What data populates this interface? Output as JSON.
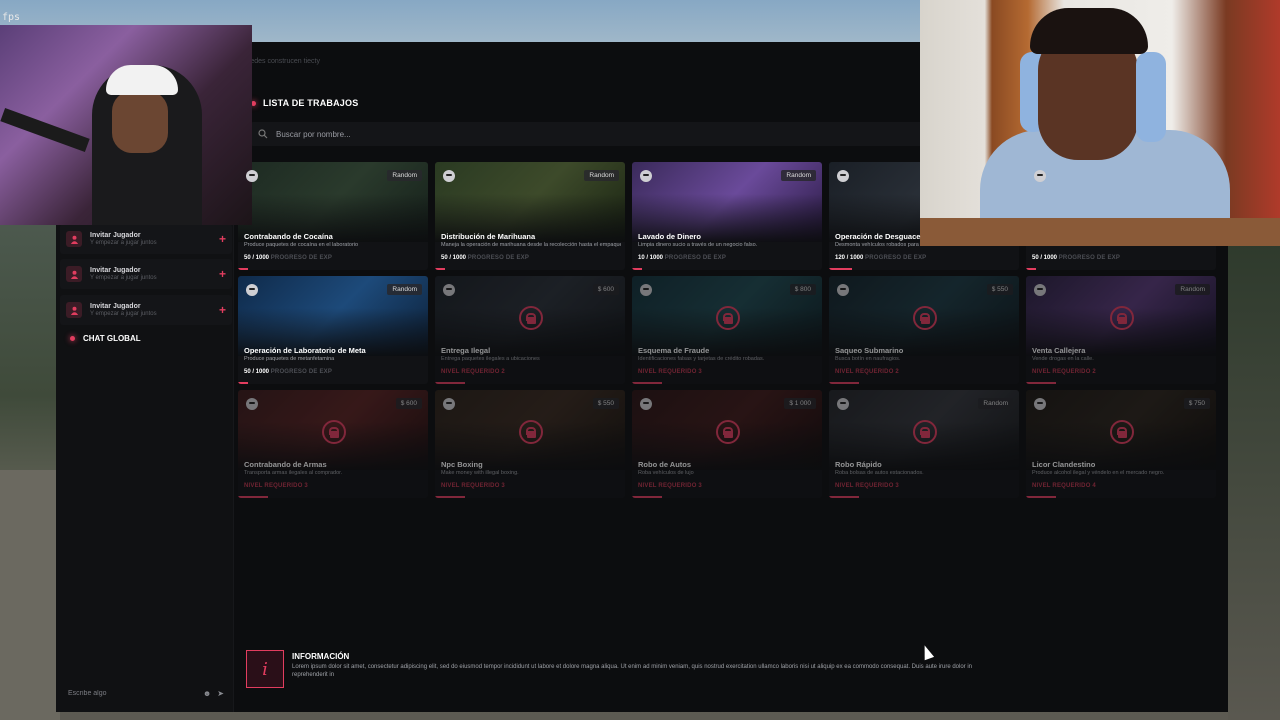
{
  "overlay": {
    "fps_label": "fps"
  },
  "header": {
    "breadcrumb": "redes construcen tiecty",
    "list_title": "LISTA DE TRABAJOS",
    "search_placeholder": "Buscar por nombre..."
  },
  "sidebar": {
    "invites": [
      {
        "name": "Invitar Jugador",
        "sub": "Y empezar a jugar juntos"
      },
      {
        "name": "Invitar Jugador",
        "sub": "Y empezar a jugar juntos"
      },
      {
        "name": "Invitar Jugador",
        "sub": "Y empezar a jugar juntos"
      }
    ],
    "chat_title": "CHAT GLOBAL",
    "chat_placeholder": "Escribe algo"
  },
  "progress_label": "PROGRESO DE EXP",
  "jobs": [
    {
      "title": "Contrabando de Cocaína",
      "desc": "Produce paquetes de cocaína en el laboratorio",
      "tag": "Random",
      "progress": "50 / 1000",
      "progress_fraction": 0.05,
      "locked": false
    },
    {
      "title": "Distribución de Marihuana",
      "desc": "Maneja la operación de marihuana desde la recolección hasta el empaquetado.",
      "tag": "Random",
      "progress": "50 / 1000",
      "progress_fraction": 0.05,
      "locked": false
    },
    {
      "title": "Lavado de Dinero",
      "desc": "Limpia dinero sucio a través de un negocio falso.",
      "tag": "Random",
      "progress": "10 / 1000",
      "progress_fraction": 0.01,
      "locked": false
    },
    {
      "title": "Operación de Desguace",
      "desc": "Desmonta vehículos robados para",
      "tag": "",
      "progress": "120 / 1000",
      "progress_fraction": 0.12,
      "locked": false
    },
    {
      "title": "",
      "desc": "",
      "tag": "",
      "progress": "50 / 1000",
      "progress_fraction": 0.05,
      "locked": false
    },
    {
      "title": "Operación de Laboratorio de Meta",
      "desc": "Produce paquetes de metanfetamina",
      "tag": "Random",
      "progress": "50 / 1000",
      "progress_fraction": 0.05,
      "locked": false
    },
    {
      "title": "Entrega Ilegal",
      "desc": "Entrega paquetes ilegales a ubicaciones",
      "tag": "$ 600",
      "requirement": "NIVEL REQUERIDO 2",
      "locked": true
    },
    {
      "title": "Esquema de Fraude",
      "desc": "Identificaciones falsas y tarjetas de crédito robadas.",
      "tag": "$ 800",
      "requirement": "NIVEL REQUERIDO 3",
      "locked": true
    },
    {
      "title": "Saqueo Submarino",
      "desc": "Busca botín en naufragios.",
      "tag": "$ 550",
      "requirement": "NIVEL REQUERIDO 2",
      "locked": true
    },
    {
      "title": "Venta Callejera",
      "desc": "Vende drogas en la calle.",
      "tag": "Random",
      "requirement": "NIVEL REQUERIDO 2",
      "locked": true
    },
    {
      "title": "Contrabando de Armas",
      "desc": "Transporta armas ilegales al comprador.",
      "tag": "$ 600",
      "requirement": "NIVEL REQUERIDO 3",
      "locked": true
    },
    {
      "title": "Npc Boxing",
      "desc": "Make money with illegal boxing.",
      "tag": "$ 550",
      "requirement": "NIVEL REQUERIDO 3",
      "locked": true
    },
    {
      "title": "Robo de Autos",
      "desc": "Roba vehículos de lujo",
      "tag": "$ 1 000",
      "requirement": "NIVEL REQUERIDO 3",
      "locked": true
    },
    {
      "title": "Robo Rápido",
      "desc": "Roba bolsas de autos estacionados.",
      "tag": "Random",
      "requirement": "NIVEL REQUERIDO 3",
      "locked": true
    },
    {
      "title": "Licor Clandestino",
      "desc": "Produce alcohol ilegal y véndelo en el mercado negro.",
      "tag": "$ 750",
      "requirement": "NIVEL REQUERIDO 4",
      "locked": true
    }
  ],
  "info": {
    "title": "INFORMACIÓN",
    "text": "Lorem ipsum dolor sit amet, consectetur adipiscing elit, sed do eiusmod tempor incididunt ut labore et dolore magna aliqua. Ut enim ad minim veniam, quis nostrud exercitation ullamco laboris nisi ut aliquip ex ea commodo consequat. Duis aute irure dolor in reprehenderit in"
  },
  "colors": {
    "accent": "#e23d5f",
    "panel": "#0c0d0f",
    "card": "#111215"
  }
}
